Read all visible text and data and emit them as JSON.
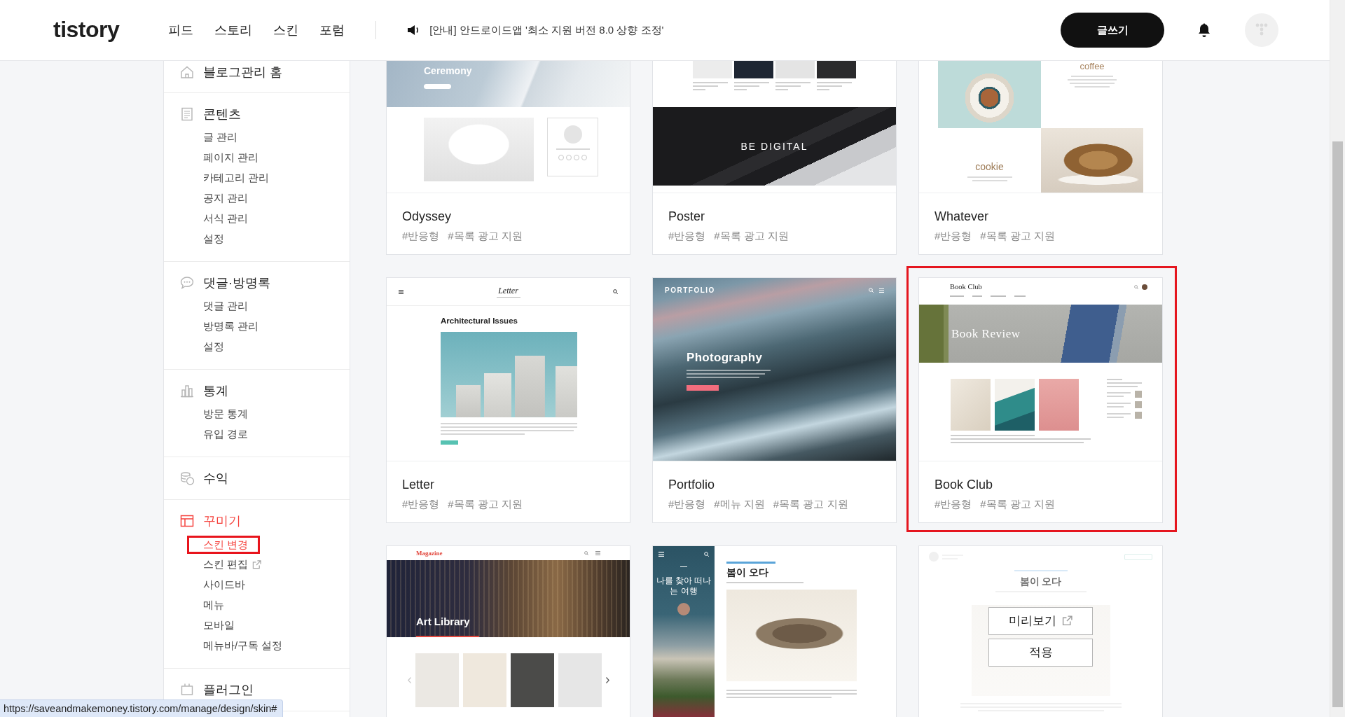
{
  "header": {
    "logo": "tistory",
    "nav": [
      "피드",
      "스토리",
      "스킨",
      "포럼"
    ],
    "notice": "[안내] 안드로이드앱 '최소 지원 버전 8.0 상향 조정'",
    "write_button": "글쓰기"
  },
  "sidebar": {
    "sections": [
      {
        "title": "블로그관리 홈",
        "selected": false
      },
      {
        "title": "콘텐츠",
        "selected": false,
        "items": [
          {
            "label": "글 관리",
            "selected": false,
            "highlighted": false,
            "external": false
          },
          {
            "label": "페이지 관리",
            "selected": false,
            "highlighted": false,
            "external": false
          },
          {
            "label": "카테고리 관리",
            "selected": false,
            "highlighted": false,
            "external": false
          },
          {
            "label": "공지 관리",
            "selected": false,
            "highlighted": false,
            "external": false
          },
          {
            "label": "서식 관리",
            "selected": false,
            "highlighted": false,
            "external": false
          },
          {
            "label": "설정",
            "selected": false,
            "highlighted": false,
            "external": false
          }
        ]
      },
      {
        "title": "댓글·방명록",
        "selected": false,
        "items": [
          {
            "label": "댓글 관리",
            "selected": false,
            "highlighted": false,
            "external": false
          },
          {
            "label": "방명록 관리",
            "selected": false,
            "highlighted": false,
            "external": false
          },
          {
            "label": "설정",
            "selected": false,
            "highlighted": false,
            "external": false
          }
        ]
      },
      {
        "title": "통계",
        "selected": false,
        "items": [
          {
            "label": "방문 통계",
            "selected": false,
            "highlighted": false,
            "external": false
          },
          {
            "label": "유입 경로",
            "selected": false,
            "highlighted": false,
            "external": false
          }
        ]
      },
      {
        "title": "수익",
        "selected": false
      },
      {
        "title": "꾸미기",
        "selected": true,
        "items": [
          {
            "label": "스킨 변경",
            "selected": true,
            "highlighted": true,
            "external": false
          },
          {
            "label": "스킨 편집",
            "selected": false,
            "highlighted": false,
            "external": true
          },
          {
            "label": "사이드바",
            "selected": false,
            "highlighted": false,
            "external": false
          },
          {
            "label": "메뉴",
            "selected": false,
            "highlighted": false,
            "external": false
          },
          {
            "label": "모바일",
            "selected": false,
            "highlighted": false,
            "external": false
          },
          {
            "label": "메뉴바/구독 설정",
            "selected": false,
            "highlighted": false,
            "external": false
          }
        ]
      },
      {
        "title": "플러그인",
        "selected": false
      }
    ]
  },
  "skins": [
    {
      "name": "Odyssey",
      "tags": [
        "#반응형",
        "#목록 광고 지원"
      ],
      "highlighted": false,
      "hovered": false,
      "preview": {
        "kind": "hero",
        "texts": [
          "Ceremony"
        ]
      }
    },
    {
      "name": "Poster",
      "tags": [
        "#반응형",
        "#목록 광고 지원"
      ],
      "highlighted": false,
      "hovered": false,
      "preview": {
        "kind": "banner",
        "texts": [
          "BE DIGITAL"
        ]
      }
    },
    {
      "name": "Whatever",
      "tags": [
        "#반응형",
        "#목록 광고 지원"
      ],
      "highlighted": false,
      "hovered": false,
      "preview": {
        "kind": "checker",
        "texts": [
          "coffee",
          "cookie"
        ]
      }
    },
    {
      "name": "Letter",
      "tags": [
        "#반응형",
        "#목록 광고 지원"
      ],
      "highlighted": false,
      "hovered": false,
      "preview": {
        "kind": "article",
        "texts": [
          "Letter",
          "Architectural Issues"
        ]
      }
    },
    {
      "name": "Portfolio",
      "tags": [
        "#반응형",
        "#메뉴 지원",
        "#목록 광고 지원"
      ],
      "highlighted": false,
      "hovered": false,
      "preview": {
        "kind": "cover",
        "texts": [
          "PORTFOLIO",
          "Photography"
        ]
      }
    },
    {
      "name": "Book Club",
      "tags": [
        "#반응형",
        "#목록 광고 지원"
      ],
      "highlighted": true,
      "hovered": false,
      "preview": {
        "kind": "books",
        "texts": [
          "Book Club",
          "Book Review"
        ]
      }
    },
    {
      "highlighted": false,
      "hovered": false,
      "preview": {
        "kind": "gallery",
        "texts": [
          "Magazine",
          "Art Library"
        ]
      }
    },
    {
      "highlighted": false,
      "hovered": false,
      "preview": {
        "kind": "column",
        "texts": [
          "나를 찾아 떠나는 여행",
          "봄이 오다"
        ]
      }
    },
    {
      "highlighted": false,
      "hovered": true,
      "actions": [
        {
          "label": "미리보기",
          "external": true
        },
        {
          "label": "적용",
          "external": false
        }
      ],
      "preview": {
        "kind": "centered",
        "texts": [
          "봄이 오다"
        ]
      }
    }
  ],
  "status_bar": {
    "url": "https://saveandmakemoney.tistory.com/manage/design/skin#"
  }
}
